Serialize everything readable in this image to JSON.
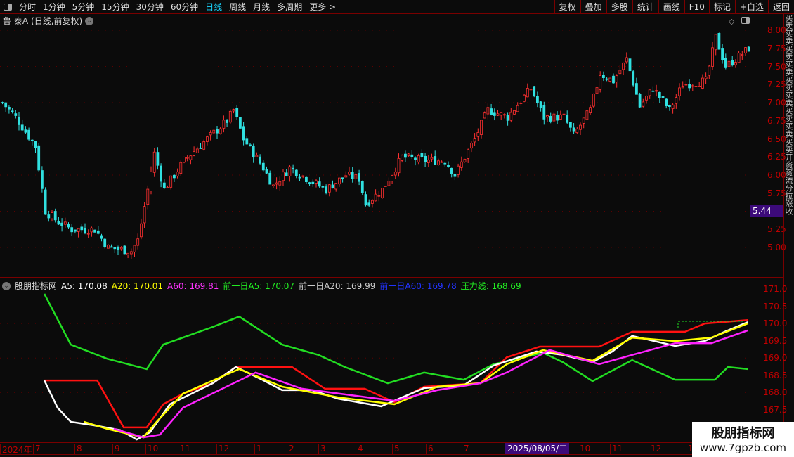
{
  "toolbar": {
    "periods": [
      "分时",
      "1分钟",
      "5分钟",
      "15分钟",
      "30分钟",
      "60分钟",
      "日线",
      "周线",
      "月线",
      "多周期",
      "更多 >"
    ],
    "active": "日线",
    "buttons": [
      "复权",
      "叠加",
      "多股",
      "统计",
      "画线",
      "F10",
      "标记",
      "+自选",
      "返回"
    ]
  },
  "title": {
    "stock": "鲁 泰A",
    "mode": "(日线,前复权)"
  },
  "price_axis": {
    "ticks": [
      "8.00",
      "7.75",
      "7.50",
      "7.25",
      "7.00",
      "6.75",
      "6.50",
      "6.25",
      "6.00",
      "5.75",
      "5.25",
      "5.00"
    ],
    "current": "5.44",
    "range": [
      5.0,
      8.0
    ]
  },
  "right_strip": "买卖买卖买卖买卖买卖买卖买卖买卖买卖开资资流分拉涨收",
  "indicator": {
    "name": "股朋指标网",
    "labels": [
      {
        "t": "A5: 170.08",
        "c": "#ffffff"
      },
      {
        "t": "A20: 170.01",
        "c": "#ffff00"
      },
      {
        "t": "A60: 169.81",
        "c": "#ff33ff"
      },
      {
        "t": "前一日A5: 170.07",
        "c": "#22ee22"
      },
      {
        "t": "前一日A20: 169.99",
        "c": "#cccccc"
      },
      {
        "t": "前一日A60: 169.78",
        "c": "#2233ff"
      },
      {
        "t": "压力线: 168.69",
        "c": "#22ee22"
      }
    ],
    "ticks": [
      "171.0",
      "170.5",
      "170.0",
      "169.5",
      "169.0",
      "168.5",
      "168.0",
      "167.5"
    ],
    "range": [
      167.0,
      171.2
    ]
  },
  "date_axis": {
    "labels": [
      "2024年",
      "7",
      "8",
      "9",
      "10",
      "11",
      "12",
      "1",
      "2",
      "3",
      "4",
      "5",
      "6",
      "7",
      "2025/08/05/二",
      "10",
      "11",
      "12",
      "1"
    ],
    "cursor": "2025/08/05/二"
  },
  "watermark": {
    "line1": "股朋指标网",
    "line2": "www.7gpzb.com"
  },
  "chart_data": {
    "type": "line",
    "price_path": [
      [
        0,
        7.0
      ],
      [
        4,
        6.8
      ],
      [
        10,
        6.4
      ],
      [
        13,
        5.5
      ],
      [
        17,
        5.35
      ],
      [
        21,
        5.25
      ],
      [
        28,
        5.25
      ],
      [
        32,
        5.0
      ],
      [
        39,
        4.95
      ],
      [
        41,
        5.1
      ],
      [
        44,
        5.8
      ],
      [
        46,
        6.3
      ],
      [
        49,
        5.8
      ],
      [
        55,
        6.2
      ],
      [
        62,
        6.5
      ],
      [
        68,
        6.75
      ],
      [
        70,
        6.9
      ],
      [
        73,
        6.5
      ],
      [
        79,
        6.1
      ],
      [
        82,
        5.85
      ],
      [
        87,
        6.1
      ],
      [
        94,
        5.9
      ],
      [
        98,
        5.8
      ],
      [
        104,
        6.0
      ],
      [
        108,
        5.95
      ],
      [
        110,
        5.6
      ],
      [
        115,
        5.8
      ],
      [
        121,
        6.25
      ],
      [
        128,
        6.2
      ],
      [
        134,
        6.2
      ],
      [
        137,
        6.0
      ],
      [
        143,
        6.5
      ],
      [
        147,
        6.9
      ],
      [
        153,
        6.8
      ],
      [
        160,
        7.2
      ],
      [
        164,
        6.8
      ],
      [
        170,
        6.8
      ],
      [
        173,
        6.55
      ],
      [
        178,
        6.9
      ],
      [
        181,
        7.4
      ],
      [
        185,
        7.3
      ],
      [
        189,
        7.6
      ],
      [
        193,
        6.95
      ],
      [
        197,
        7.2
      ],
      [
        202,
        6.9
      ],
      [
        206,
        7.25
      ],
      [
        213,
        7.3
      ],
      [
        216,
        7.9
      ],
      [
        219,
        7.5
      ],
      [
        222,
        7.6
      ],
      [
        226,
        7.75
      ]
    ],
    "series": [
      {
        "name": "压力线",
        "color": "#22dd22",
        "points": [
          [
            13,
            170.86
          ],
          [
            21,
            169.39
          ],
          [
            32,
            168.98
          ],
          [
            44,
            168.68
          ],
          [
            49,
            169.39
          ],
          [
            64,
            169.9
          ],
          [
            72,
            170.2
          ],
          [
            85,
            169.39
          ],
          [
            96,
            169.09
          ],
          [
            104,
            168.74
          ],
          [
            117,
            168.27
          ],
          [
            128,
            168.58
          ],
          [
            140,
            168.37
          ],
          [
            149,
            168.82
          ],
          [
            164,
            169.15
          ],
          [
            170,
            168.88
          ],
          [
            179,
            168.33
          ],
          [
            191,
            168.94
          ],
          [
            204,
            168.37
          ],
          [
            216,
            168.37
          ],
          [
            220,
            168.74
          ],
          [
            226,
            168.68
          ]
        ]
      },
      {
        "name": "前一日A20",
        "color": "#ff1111",
        "points": [
          [
            13,
            168.35
          ],
          [
            29,
            168.35
          ],
          [
            37,
            166.99
          ],
          [
            44,
            166.99
          ],
          [
            49,
            167.66
          ],
          [
            55,
            167.97
          ],
          [
            64,
            168.27
          ],
          [
            71,
            168.74
          ],
          [
            88,
            168.74
          ],
          [
            98,
            168.11
          ],
          [
            110,
            168.11
          ],
          [
            119,
            167.72
          ],
          [
            128,
            168.17
          ],
          [
            145,
            168.27
          ],
          [
            153,
            169.02
          ],
          [
            163,
            169.33
          ],
          [
            181,
            169.33
          ],
          [
            191,
            169.76
          ],
          [
            207,
            169.76
          ],
          [
            213,
            170.0
          ],
          [
            226,
            170.1
          ]
        ]
      },
      {
        "name": "A5",
        "color": "#ffffff",
        "points": [
          [
            13,
            168.35
          ],
          [
            17,
            167.56
          ],
          [
            21,
            167.15
          ],
          [
            28,
            167.05
          ],
          [
            36,
            166.91
          ],
          [
            41,
            166.64
          ],
          [
            45,
            166.85
          ],
          [
            51,
            167.66
          ],
          [
            64,
            168.27
          ],
          [
            71,
            168.74
          ],
          [
            79,
            168.37
          ],
          [
            85,
            168.07
          ],
          [
            94,
            168.07
          ],
          [
            102,
            167.82
          ],
          [
            115,
            167.6
          ],
          [
            128,
            168.13
          ],
          [
            140,
            168.21
          ],
          [
            149,
            168.78
          ],
          [
            162,
            169.19
          ],
          [
            170,
            169.09
          ],
          [
            179,
            168.88
          ],
          [
            185,
            169.19
          ],
          [
            191,
            169.64
          ],
          [
            204,
            169.35
          ],
          [
            213,
            169.49
          ],
          [
            219,
            169.76
          ],
          [
            226,
            170.04
          ]
        ]
      },
      {
        "name": "A20",
        "color": "#ffff00",
        "points": [
          [
            25,
            167.15
          ],
          [
            32,
            166.95
          ],
          [
            43,
            166.7
          ],
          [
            47,
            167.15
          ],
          [
            55,
            167.97
          ],
          [
            72,
            168.68
          ],
          [
            85,
            168.17
          ],
          [
            102,
            167.86
          ],
          [
            119,
            167.66
          ],
          [
            132,
            168.17
          ],
          [
            145,
            168.27
          ],
          [
            153,
            168.82
          ],
          [
            164,
            169.23
          ],
          [
            179,
            168.92
          ],
          [
            191,
            169.59
          ],
          [
            204,
            169.49
          ],
          [
            215,
            169.59
          ],
          [
            226,
            170.0
          ]
        ]
      },
      {
        "name": "A60",
        "color": "#ff22ff",
        "points": [
          [
            34,
            166.95
          ],
          [
            43,
            166.7
          ],
          [
            48,
            166.78
          ],
          [
            55,
            167.56
          ],
          [
            77,
            168.58
          ],
          [
            91,
            168.11
          ],
          [
            111,
            167.86
          ],
          [
            119,
            167.76
          ],
          [
            132,
            168.07
          ],
          [
            145,
            168.27
          ],
          [
            153,
            168.58
          ],
          [
            166,
            169.23
          ],
          [
            181,
            168.82
          ],
          [
            191,
            169.09
          ],
          [
            204,
            169.43
          ],
          [
            215,
            169.43
          ],
          [
            226,
            169.8
          ]
        ]
      }
    ]
  }
}
